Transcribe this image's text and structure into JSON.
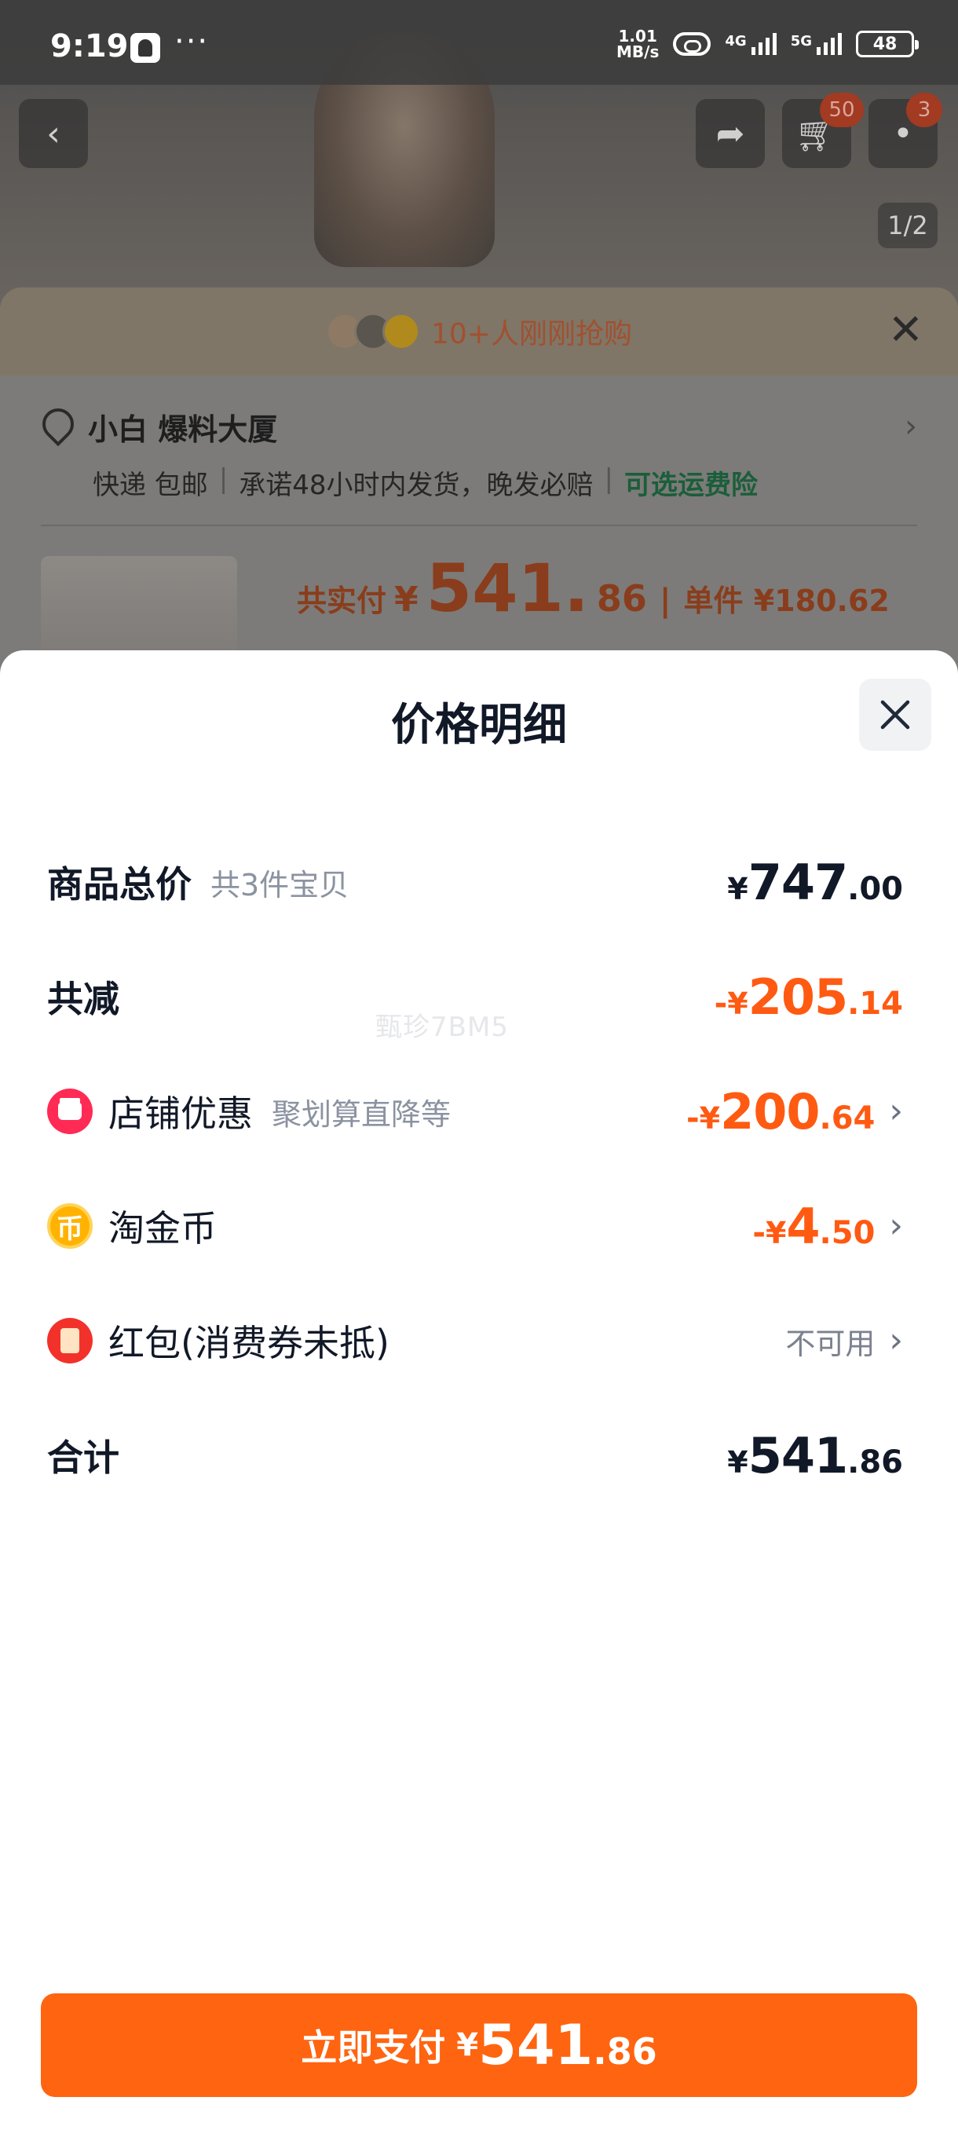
{
  "status_bar": {
    "time": "9:19",
    "dots": "···",
    "net_speed_value": "1.01",
    "net_speed_unit": "MB/s",
    "signal1_label": "4G",
    "signal2_label": "5G",
    "battery": "48"
  },
  "background": {
    "cart_badge": "50",
    "msg_badge": "3",
    "page_indicator": "1/2",
    "buyers_text": "10+人刚刚抢购",
    "address": "小白 爆料大厦",
    "shipping": [
      "快递 包邮",
      "承诺48小时内发货，晚发必赔"
    ],
    "shipping_insurance": "可选运费险",
    "total_label": "共实付",
    "total_currency": "¥",
    "total_int": "541.",
    "total_dec": "86",
    "unit_price": "单件 ¥180.62",
    "separator": "|"
  },
  "sheet": {
    "title": "价格明细",
    "watermark": "甄珍7BM5",
    "rows": [
      {
        "label": "商品总价",
        "sub": "共3件宝贝",
        "sign": "",
        "currency": "¥",
        "int": "747",
        "dec": ".00"
      },
      {
        "label": "共减",
        "sign": "-",
        "currency": "¥",
        "int": "205",
        "dec": ".14"
      },
      {
        "label": "店铺优惠",
        "sub": "聚划算直降等",
        "sign": "-",
        "currency": "¥",
        "int": "200",
        "dec": ".64",
        "icon": "shop-icon"
      },
      {
        "label": "淘金币",
        "sign": "-",
        "currency": "¥",
        "int": "4",
        "dec": ".50",
        "icon": "coin-icon",
        "icon_glyph": "币"
      },
      {
        "label": "红包(消费券未抵)",
        "status": "不可用",
        "icon": "red-packet-icon"
      },
      {
        "label": "合计",
        "sign": "",
        "currency": "¥",
        "int": "541",
        "dec": ".86"
      }
    ],
    "pay_button": {
      "label": "立即支付",
      "currency": "¥",
      "int": "541",
      "dec": ".86"
    }
  },
  "colors": {
    "accent_orange": "#ff6410",
    "discount_orange": "#ff5a12",
    "text_dark": "#111827",
    "text_muted": "#8b93a1"
  }
}
